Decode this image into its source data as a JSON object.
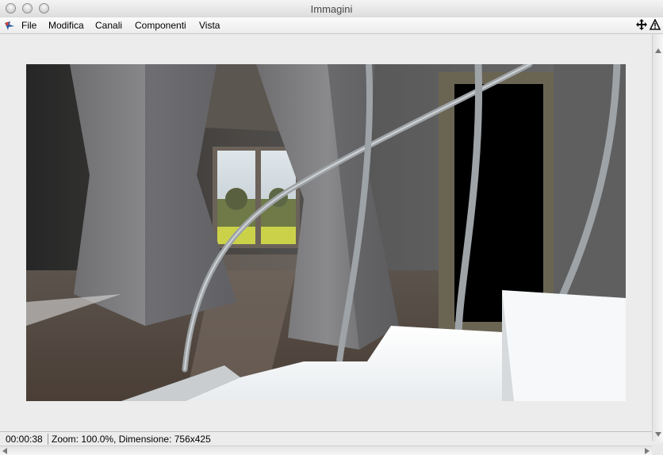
{
  "window": {
    "title": "Immagini"
  },
  "menu": {
    "items": [
      {
        "label": "File"
      },
      {
        "label": "Modifica"
      },
      {
        "label": "Canali"
      },
      {
        "label": "Componenti"
      },
      {
        "label": "Vista"
      }
    ],
    "app_icon": "cinema4d-render-icon",
    "right_icons": [
      "move-icon",
      "warning-triangle-icon"
    ]
  },
  "render": {
    "subject": "interior-render-image"
  },
  "status": {
    "time": "00:00:38",
    "info": "Zoom: 100.0%, Dimensione: 756x425"
  },
  "colors": {
    "window_bg": "#ececec",
    "titlebar": "#dcdcdc"
  }
}
